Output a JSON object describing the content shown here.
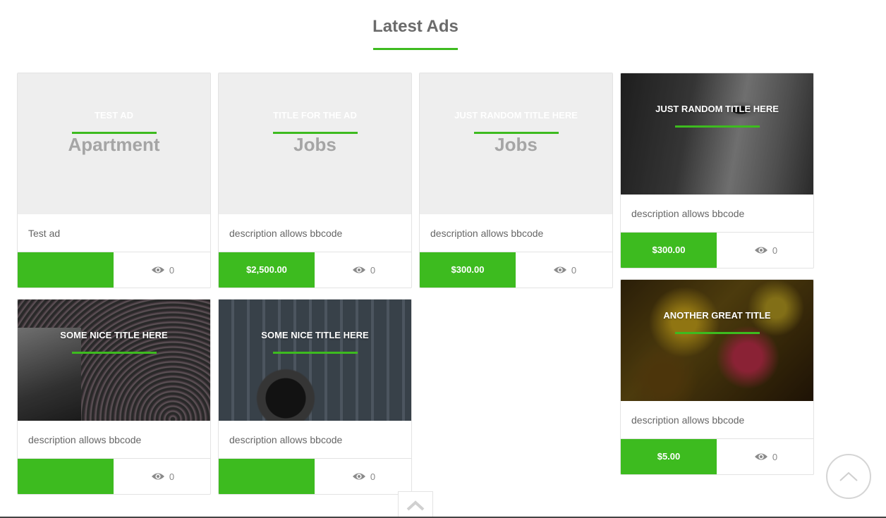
{
  "section": {
    "title": "Latest Ads"
  },
  "colors": {
    "accent": "#3dbb1f"
  },
  "ads": [
    {
      "title": "TEST AD",
      "category": "Apartment",
      "description": "Test ad",
      "price": "",
      "views": "0"
    },
    {
      "title": "TITLE FOR THE AD",
      "category": "Jobs",
      "description": "description allows bbcode",
      "price": "$2,500.00",
      "views": "0"
    },
    {
      "title": "JUST RANDOM TITLE HERE",
      "category": "Jobs",
      "description": "description allows bbcode",
      "price": "$300.00",
      "views": "0"
    },
    {
      "title": "JUST RANDOM TITLE HERE",
      "category": "",
      "description": "description allows bbcode",
      "price": "$300.00",
      "views": "0"
    },
    {
      "title": "SOME NICE TITLE HERE",
      "category": "",
      "description": "description allows bbcode",
      "price": "",
      "views": "0"
    },
    {
      "title": "SOME NICE TITLE HERE",
      "category": "",
      "description": "description allows bbcode",
      "price": "",
      "views": "0"
    },
    {
      "title": "ANOTHER GREAT TITLE",
      "category": "",
      "description": "description allows bbcode",
      "price": "$5.00",
      "views": "0"
    }
  ],
  "icons": {
    "views": "eye-icon",
    "scroll_tab": "chevron-up-icon",
    "back_to_top": "chevron-up-icon"
  }
}
